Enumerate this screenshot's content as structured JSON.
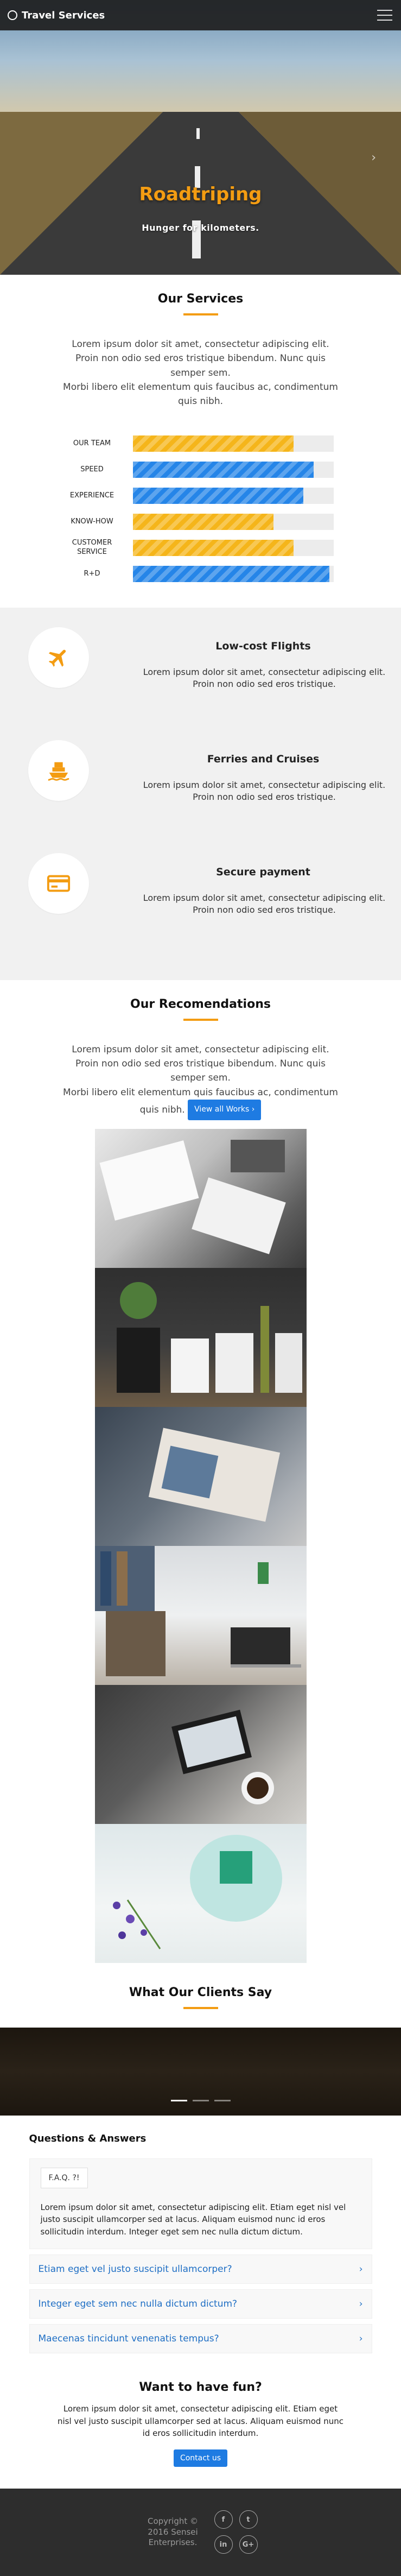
{
  "nav": {
    "brand": "Travel Services"
  },
  "hero": {
    "title": "Roadtriping",
    "subtitle": "Hunger for kilometers."
  },
  "services": {
    "title": "Our Services",
    "lead": "Lorem ipsum dolor sit amet, consectetur adipiscing elit. Proin non odio sed eros tristique bibendum. Nunc quis semper sem.",
    "lead2": "Morbi libero elit elementum quis faucibus ac, condimentum quis nibh.",
    "skills": [
      {
        "label": "OUR TEAM",
        "value": 80,
        "color": "#f5b51a"
      },
      {
        "label": "SPEED",
        "value": 90,
        "color": "#2585e8"
      },
      {
        "label": "EXPERIENCE",
        "value": 85,
        "color": "#2585e8"
      },
      {
        "label": "KNOW-HOW",
        "value": 70,
        "color": "#f5b51a"
      },
      {
        "label": "CUSTOMER SERVICE",
        "value": 80,
        "color": "#f5b51a"
      },
      {
        "label": "R+D",
        "value": 98,
        "color": "#2585e8"
      }
    ]
  },
  "features": [
    {
      "title": "Low-cost Flights",
      "text": "Lorem ipsum dolor sit amet, consectetur adipiscing elit. Proin non odio sed eros tristique.",
      "icon": "plane-icon"
    },
    {
      "title": "Ferries and Cruises",
      "text": "Lorem ipsum dolor sit amet, consectetur adipiscing elit. Proin non odio sed eros tristique.",
      "icon": "ship-icon"
    },
    {
      "title": "Secure payment",
      "text": "Lorem ipsum dolor sit amet, consectetur adipiscing elit. Proin non odio sed eros tristique.",
      "icon": "credit-card-icon"
    }
  ],
  "recommendations": {
    "title": "Our Recomendations",
    "lead": "Lorem ipsum dolor sit amet, consectetur adipiscing elit. Proin non odio sed eros tristique bibendum. Nunc quis semper sem.",
    "lead2": "Morbi libero elit elementum quis faucibus ac, condimentum quis nibh.",
    "button": "View all Works ›"
  },
  "clients": {
    "title": "What Our Clients Say"
  },
  "faq": {
    "title": "Questions & Answers",
    "tab": "F.A.Q. ?!",
    "body": "Lorem ipsum dolor sit amet, consectetur adipiscing elit. Etiam eget nisl vel justo suscipit ullamcorper sed at lacus. Aliquam euismod nunc id eros sollicitudin interdum. Integer eget sem nec nulla dictum dictum.",
    "questions": [
      "Etiam eget vel justo suscipit ullamcorper?",
      "Integer eget sem nec nulla dictum dictum?",
      "Maecenas tincidunt venenatis tempus?"
    ]
  },
  "fun": {
    "title": "Want to have fun?",
    "text": "Lorem ipsum dolor sit amet, consectetur adipiscing elit. Etiam eget nisl vel justo suscipit ullamcorper sed at lacus. Aliquam euismod nunc id eros sollicitudin interdum.",
    "button": "Contact us"
  },
  "footer": {
    "copyright": "Copyright © 2016 Sensei Enterprises.",
    "socials": [
      "f",
      "t",
      "in",
      "G+"
    ]
  }
}
